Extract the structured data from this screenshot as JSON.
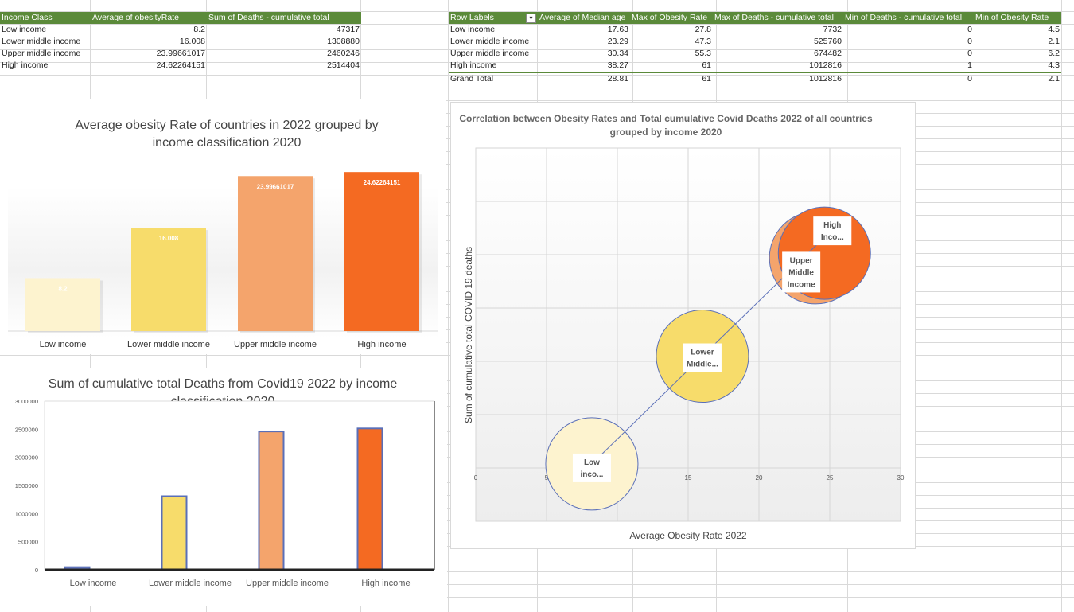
{
  "table1": {
    "headers": [
      "Income Class",
      "Average of obesityRate",
      "Sum of Deaths - cumulative total"
    ],
    "rows": [
      [
        "Low income",
        "8.2",
        "47317"
      ],
      [
        "Lower middle income",
        "16.008",
        "1308880"
      ],
      [
        "Upper middle income",
        "23.99661017",
        "2460246"
      ],
      [
        "High income",
        "24.62264151",
        "2514404"
      ]
    ]
  },
  "table2": {
    "headers": [
      "Row Labels",
      "Average of Median age",
      "Max of Obesity Rate",
      "Max of Deaths - cumulative total",
      "Min of Deaths - cumulative total",
      "Min of Obesity Rate"
    ],
    "rows": [
      [
        "Low income",
        "17.63",
        "27.8",
        "7732",
        "0",
        "4.5"
      ],
      [
        "Lower middle income",
        "23.29",
        "47.3",
        "525760",
        "0",
        "2.1"
      ],
      [
        "Upper middle income",
        "30.34",
        "55.3",
        "674482",
        "0",
        "6.2"
      ],
      [
        "High income",
        "38.27",
        "61",
        "1012816",
        "1",
        "4.3"
      ]
    ],
    "total": [
      "Grand Total",
      "28.81",
      "61",
      "1012816",
      "0",
      "2.1"
    ],
    "filter_icon": "sort-filter-icon"
  },
  "chart_data": [
    {
      "type": "bar",
      "title": "Average obesity Rate of countries in 2022 grouped by income classification 2020",
      "categories": [
        "Low income",
        "Lower middle income",
        "Upper middle income",
        "High income"
      ],
      "values": [
        8.2,
        16.008,
        23.99661017,
        24.62264151
      ],
      "data_labels": [
        "8.2",
        "16.008",
        "23.99661017",
        "24.62264151"
      ],
      "colors": [
        "#fdf3cf",
        "#f7dc6b",
        "#f4a46c",
        "#f46a22"
      ],
      "ylim": [
        0,
        26
      ],
      "grid": false,
      "legend": "none"
    },
    {
      "type": "bar",
      "title": "Sum of cumulative total Deaths from Covid19 2022 by income classification 2020",
      "categories": [
        "Low income",
        "Lower middle income",
        "Upper middle income",
        "High income"
      ],
      "values": [
        47317,
        1308880,
        2460246,
        2514404
      ],
      "yticks": [
        "0",
        "500000",
        "1000000",
        "1500000",
        "2000000",
        "2500000",
        "3000000"
      ],
      "ylim": [
        0,
        3000000
      ],
      "colors": [
        "#6b7fc4",
        "#f7dc6b",
        "#f4a46c",
        "#f46a22"
      ],
      "border_color": "#5a6fb8",
      "grid": false,
      "legend": "none"
    },
    {
      "type": "scatter",
      "subtype": "bubble",
      "title": "Correlation between Obesity Rates and Total cumulative Covid Deaths 2022 of all countries grouped by income 2020",
      "xlabel": "Average Obesity Rate 2022",
      "ylabel": "Sum of cumulative total COVID 19 deaths",
      "xlim": [
        0,
        30
      ],
      "xticks": [
        "0",
        "5",
        "10",
        "15",
        "20",
        "25",
        "30"
      ],
      "trendline": true,
      "grid": true,
      "points": [
        {
          "label": "Low inco...",
          "x": 8.2,
          "y": 47317,
          "color": "#fdf3cf"
        },
        {
          "label": "Lower Middle...",
          "x": 16.008,
          "y": 1308880,
          "color": "#f7dc6b"
        },
        {
          "label": "Upper Middle Income",
          "x": 23.99661017,
          "y": 2460246,
          "color": "#f4a46c"
        },
        {
          "label": "High Inco...",
          "x": 24.62264151,
          "y": 2514404,
          "color": "#f46a22"
        }
      ],
      "ylim": [
        0,
        3000000
      ]
    }
  ]
}
